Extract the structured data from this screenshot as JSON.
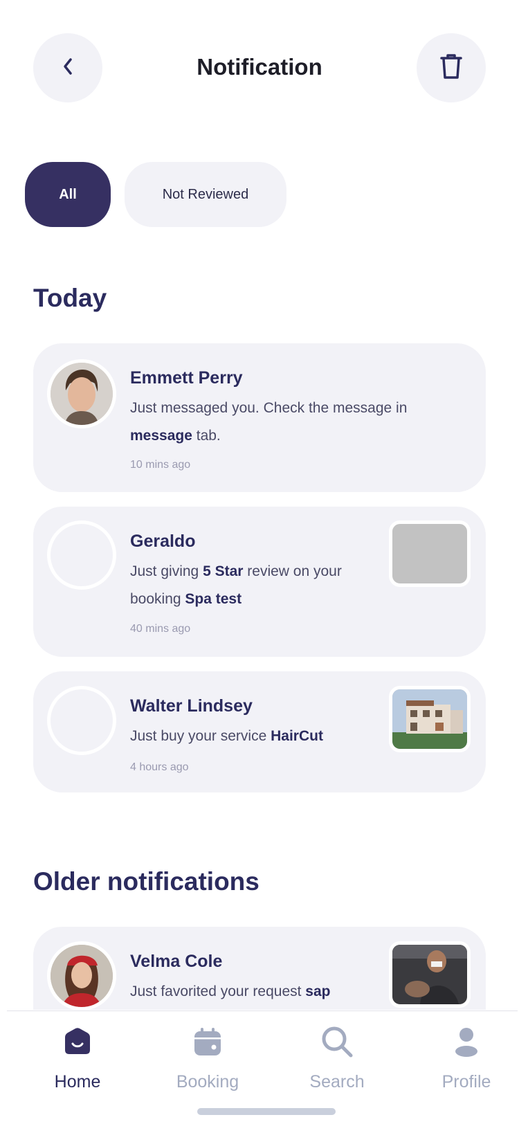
{
  "header": {
    "title": "Notification",
    "back_icon": "chevron-left-icon",
    "delete_icon": "trash-icon"
  },
  "filters": {
    "all_label": "All",
    "not_reviewed_label": "Not Reviewed",
    "selected": "All"
  },
  "sections": {
    "today_title": "Today",
    "older_title": "Older notifications"
  },
  "notifications": [
    {
      "name": "Emmett Perry",
      "message_parts": [
        "Just messaged you. Check the message in ",
        "message",
        " tab."
      ],
      "time": "10 mins ago",
      "has_thumbnail": false
    },
    {
      "name": "Geraldo",
      "message_parts": [
        "Just giving ",
        "5 Star",
        " review on your booking ",
        "Spa test"
      ],
      "time": "40 mins ago",
      "has_thumbnail": true
    },
    {
      "name": "Walter Lindsey",
      "message_parts": [
        "Just buy your service ",
        "HairCut"
      ],
      "time": "4 hours ago",
      "has_thumbnail": true
    },
    {
      "name": "Velma Cole",
      "message_parts": [
        "Just favorited your request ",
        "sap"
      ],
      "has_thumbnail": true
    }
  ],
  "nav": {
    "items": [
      {
        "label": "Home",
        "icon": "home-icon",
        "active": true
      },
      {
        "label": "Booking",
        "icon": "calendar-icon",
        "active": false
      },
      {
        "label": "Search",
        "icon": "search-icon",
        "active": false
      },
      {
        "label": "Profile",
        "icon": "user-icon",
        "active": false
      }
    ]
  },
  "colors": {
    "primary": "#363062",
    "card_bg": "#f2f2f7",
    "heading": "#2b2b5e",
    "nav_inactive": "#a3abc0"
  }
}
